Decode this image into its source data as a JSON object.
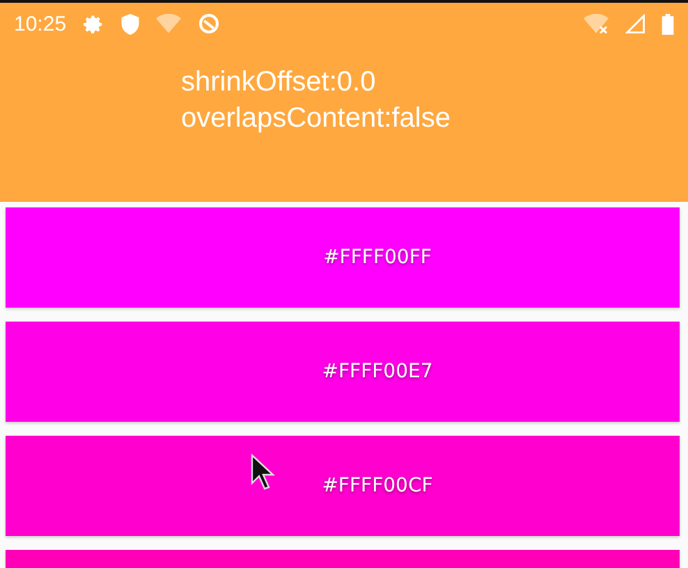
{
  "status_bar": {
    "time": "10:25"
  },
  "header": {
    "lines": [
      "shrinkOffset:0.0",
      "overlapsContent:false"
    ]
  },
  "cards": [
    {
      "label": "#FFFF00FF",
      "color": "#ff00ff"
    },
    {
      "label": "#FFFF00E7",
      "color": "#ff00e7"
    },
    {
      "label": "#FFFF00CF",
      "color": "#ff00cf"
    },
    {
      "color": "#ff00b7"
    }
  ]
}
